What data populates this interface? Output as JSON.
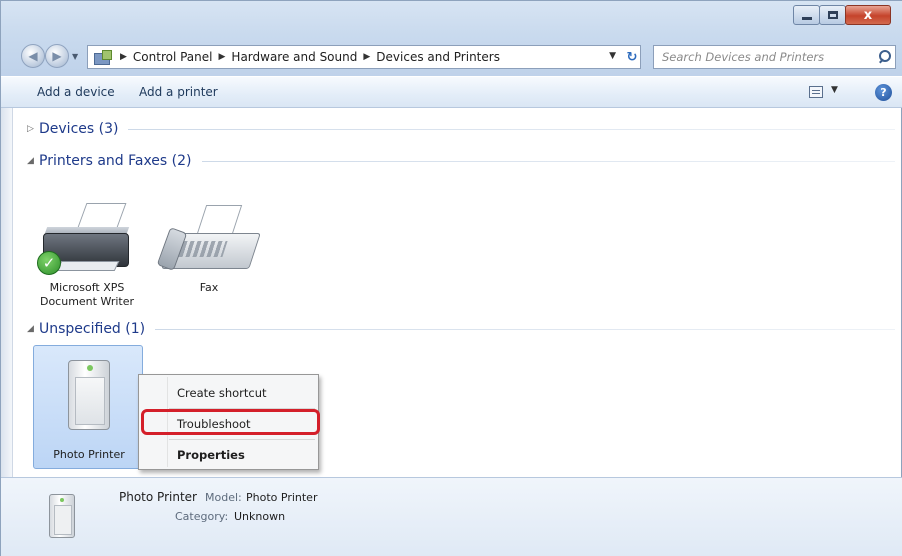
{
  "breadcrumbs": [
    "Control Panel",
    "Hardware and Sound",
    "Devices and Printers"
  ],
  "search": {
    "placeholder": "Search Devices and Printers"
  },
  "toolbar": {
    "add_device": "Add a device",
    "add_printer": "Add a printer",
    "help": "?"
  },
  "groups": {
    "devices": "Devices (3)",
    "printers": "Printers and Faxes (2)",
    "unspecified": "Unspecified (1)"
  },
  "printers": [
    {
      "name_line1": "Microsoft XPS",
      "name_line2": "Document Writer",
      "icon": "printer-icon",
      "default": true
    },
    {
      "name_line1": "Fax",
      "name_line2": "",
      "icon": "fax-icon",
      "default": false
    }
  ],
  "unspecified_items": [
    {
      "name": "Photo Printer",
      "icon": "photo-printer-icon",
      "selected": true
    }
  ],
  "context_menu": {
    "items": [
      "Create shortcut",
      "Troubleshoot",
      "Properties"
    ],
    "highlighted": "Troubleshoot",
    "highlight_color": "#d41f2a"
  },
  "details": {
    "name": "Photo Printer",
    "model_label": "Model:",
    "model_value": "Photo Printer",
    "category_label": "Category:",
    "category_value": "Unknown"
  },
  "caption": {
    "close": "x"
  }
}
